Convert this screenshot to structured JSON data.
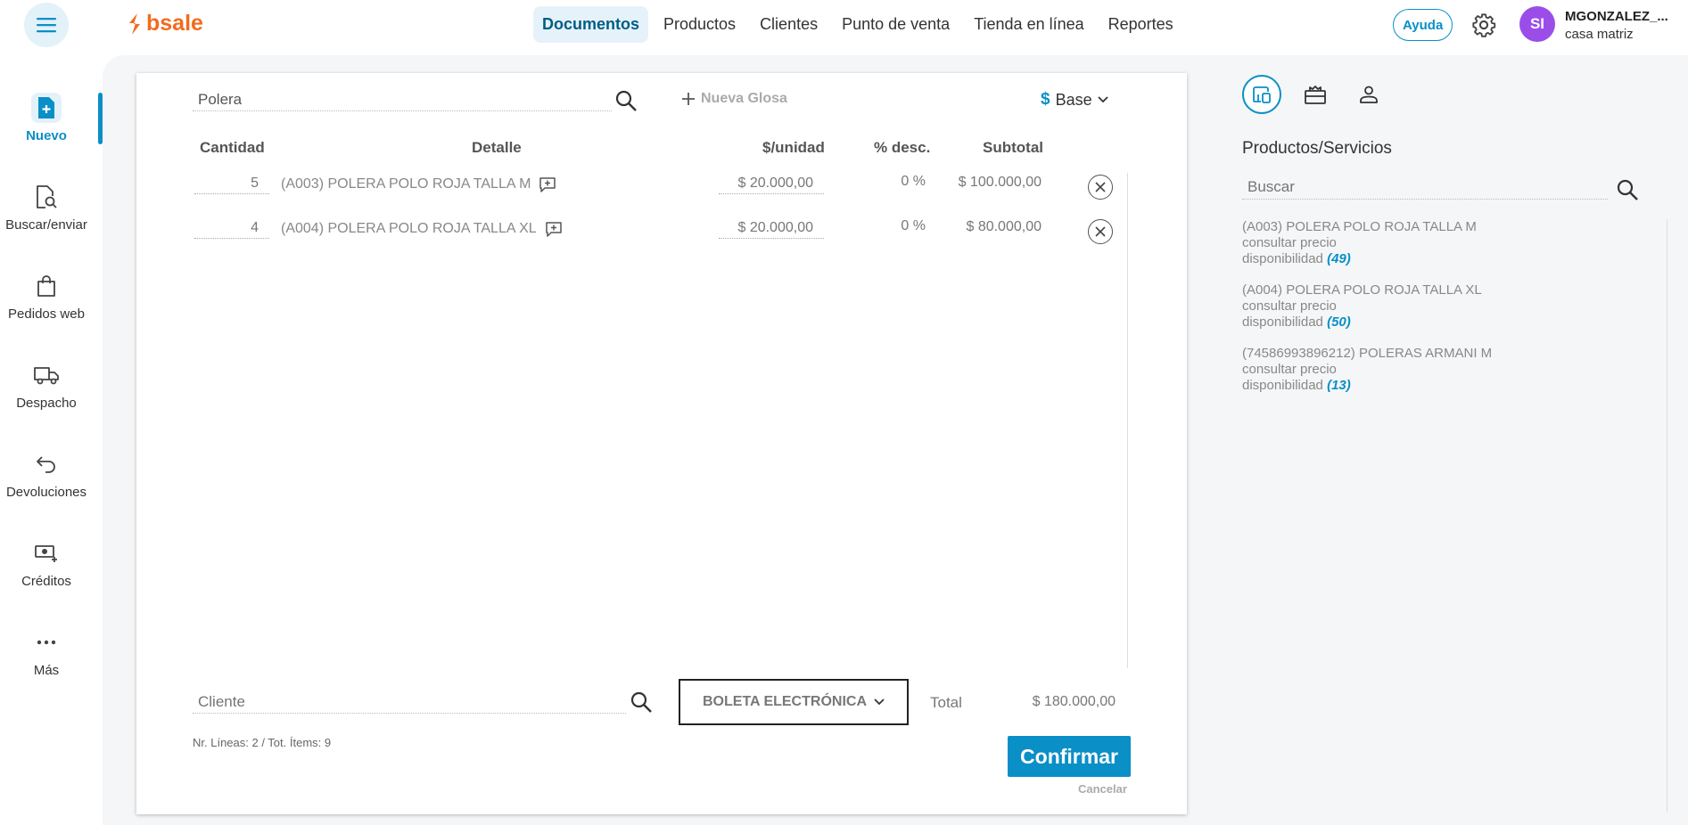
{
  "brand": {
    "name": "bsale",
    "color": "#f26b1d",
    "accent": "#0a8fc7"
  },
  "nav": [
    {
      "label": "Documentos",
      "active": true
    },
    {
      "label": "Productos",
      "active": false
    },
    {
      "label": "Clientes",
      "active": false
    },
    {
      "label": "Punto de venta",
      "active": false
    },
    {
      "label": "Tienda en línea",
      "active": false
    },
    {
      "label": "Reportes",
      "active": false
    }
  ],
  "header": {
    "help_label": "Ayuda",
    "avatar_initials": "SI",
    "user_name": "MGONZALEZ_...",
    "branch": "casa matriz"
  },
  "sidebar": [
    {
      "label": "Nuevo",
      "icon": "new-document-icon",
      "active": true
    },
    {
      "label": "Buscar/enviar",
      "icon": "document-search-icon",
      "active": false
    },
    {
      "label": "Pedidos web",
      "icon": "shopping-bag-icon",
      "active": false
    },
    {
      "label": "Despacho",
      "icon": "truck-icon",
      "active": false
    },
    {
      "label": "Devoluciones",
      "icon": "return-arrow-icon",
      "active": false
    },
    {
      "label": "Créditos",
      "icon": "money-plus-icon",
      "active": false
    },
    {
      "label": "Más",
      "icon": "more-dots-icon",
      "active": false
    }
  ],
  "document": {
    "search_value": "Polera",
    "new_glosa_label": "Nueva Glosa",
    "price_list": {
      "symbol": "$",
      "label": "Base"
    },
    "columns": {
      "qty": "Cantidad",
      "detail": "Detalle",
      "unit_price": "$/unidad",
      "discount": "% desc.",
      "subtotal": "Subtotal"
    },
    "rows": [
      {
        "qty": "5",
        "detail": "(A003) POLERA POLO ROJA TALLA M",
        "unit_price": "$ 20.000,00",
        "discount": "0 %",
        "subtotal": "$ 100.000,00"
      },
      {
        "qty": "4",
        "detail": "(A004) POLERA POLO ROJA TALLA XL",
        "unit_price": "$ 20.000,00",
        "discount": "0 %",
        "subtotal": "$ 80.000,00"
      }
    ],
    "client_placeholder": "Cliente",
    "doc_type": "BOLETA ELECTRÓNICA",
    "total_label": "Total",
    "total_value": "$ 180.000,00",
    "lines_info": "Nr. Líneas: 2 / Tot. Ítems: 9",
    "confirm_label": "Confirmar",
    "cancel_label": "Cancelar"
  },
  "right_panel": {
    "title": "Productos/Servicios",
    "search_placeholder": "Buscar",
    "products": [
      {
        "name": "(A003) POLERA POLO ROJA TALLA M",
        "price": "consultar precio",
        "availability_label": "disponibilidad",
        "availability": "(49)"
      },
      {
        "name": "(A004) POLERA POLO ROJA TALLA XL",
        "price": "consultar precio",
        "availability_label": "disponibilidad",
        "availability": "(50)"
      },
      {
        "name": "(74586993896212) POLERAS ARMANI M",
        "price": "consultar precio",
        "availability_label": "disponibilidad",
        "availability": "(13)"
      }
    ]
  }
}
